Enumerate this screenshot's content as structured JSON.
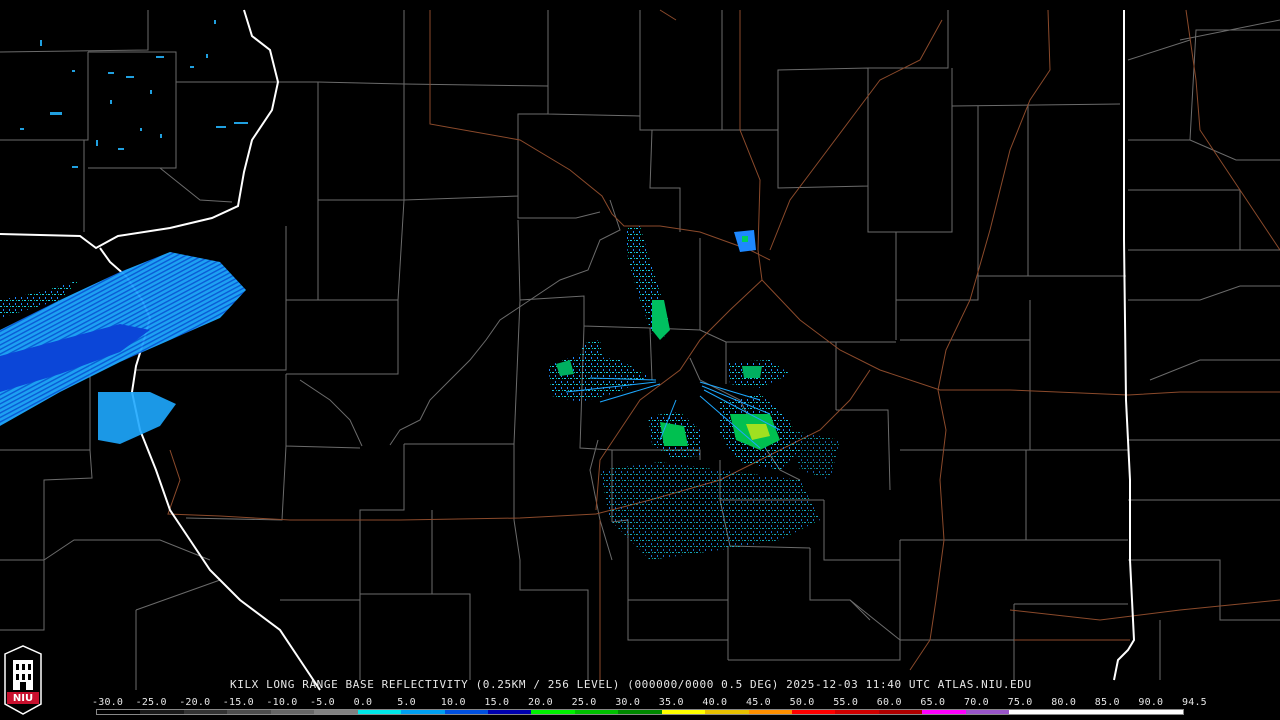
{
  "product": {
    "caption": "KILX LONG RANGE BASE REFLECTIVITY (0.25KM / 256 LEVEL) (000000/0000 0.5 DEG) 2025-12-03 11:40 UTC  ATLAS.NIU.EDU",
    "logo_text": "NIU"
  },
  "legend": {
    "labels": [
      "-30.0",
      "-25.0",
      "-20.0",
      "-15.0",
      "-10.0",
      "-5.0",
      "0.0",
      "5.0",
      "10.0",
      "15.0",
      "20.0",
      "25.0",
      "30.0",
      "35.0",
      "40.0",
      "45.0",
      "50.0",
      "55.0",
      "60.0",
      "65.0",
      "70.0",
      "75.0",
      "80.0",
      "85.0",
      "90.0",
      "94.5"
    ],
    "colors": [
      "#000000",
      "#1a1a1a",
      "#333333",
      "#4d4d4d",
      "#666666",
      "#808080",
      "#00e6e6",
      "#00a0f0",
      "#0050e0",
      "#0000b0",
      "#00f000",
      "#00c000",
      "#008800",
      "#ffff00",
      "#e6c000",
      "#ff9000",
      "#ff0000",
      "#d00000",
      "#b00000",
      "#ff00ff",
      "#9955c9",
      "#ffffff",
      "#ffffff",
      "#ffffff",
      "#ffffff"
    ]
  },
  "colors": {
    "background": "#000000",
    "county_lines": "#6b6b6b",
    "state_lines": "#ffffff",
    "highways": "#8b4a2b",
    "logo_red": "#c8102e"
  }
}
